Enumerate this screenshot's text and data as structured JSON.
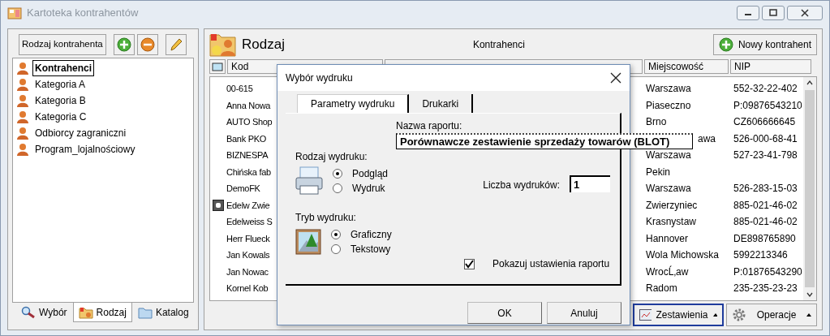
{
  "window": {
    "title": "Kartoteka kontrahentów",
    "active": false
  },
  "left_panel": {
    "type_button": "Rodzaj kontrahenta",
    "tree": [
      {
        "label": "Kontrahenci",
        "selected": true
      },
      {
        "label": "Kategoria A",
        "selected": false
      },
      {
        "label": "Kategoria B",
        "selected": false
      },
      {
        "label": "Kategoria C",
        "selected": false
      },
      {
        "label": "Odbiorcy zagraniczni",
        "selected": false
      },
      {
        "label": "Program_lojalnościowy",
        "selected": false
      }
    ],
    "tabs": [
      {
        "label": "Wybór",
        "kind": "search",
        "selected": false
      },
      {
        "label": "Rodzaj",
        "kind": "type",
        "selected": true
      },
      {
        "label": "Katalog",
        "kind": "folder",
        "selected": false
      }
    ]
  },
  "right_panel": {
    "title": "Rodzaj",
    "list_title": "Kontrahenci",
    "new_button": "Nowy kontrahent",
    "columns": {
      "kod": "Kod",
      "city": "Miejscowość",
      "nip": "NIP"
    },
    "rows": [
      {
        "kod": "00-615",
        "marked": false,
        "city": "Warszawa",
        "nip": "552-32-22-402"
      },
      {
        "kod": "Anna Nowa",
        "marked": false,
        "city": "Piaseczno",
        "nip": "P:09876543210"
      },
      {
        "kod": "AUTO Shop",
        "marked": false,
        "city": "Brno",
        "nip": "CZ606666645"
      },
      {
        "kod": "Bank PKO",
        "marked": false,
        "city": "awa",
        "nip": "526-000-68-41"
      },
      {
        "kod": "BIZNESPA",
        "marked": false,
        "city": "Warszawa",
        "nip": "527-23-41-798"
      },
      {
        "kod": "Chińska fab",
        "marked": false,
        "city": "Pekin",
        "nip": ""
      },
      {
        "kod": "DemoFK",
        "marked": false,
        "city": "Warszawa",
        "nip": "526-283-15-03"
      },
      {
        "kod": "Edelw Zwie",
        "marked": true,
        "city": "Zwierzyniec",
        "nip": "885-021-46-02"
      },
      {
        "kod": "Edelweiss S",
        "marked": false,
        "city": "Krasnystaw",
        "nip": "885-021-46-02"
      },
      {
        "kod": "Herr Flueck",
        "marked": false,
        "city": "Hannover",
        "nip": "DE898765890"
      },
      {
        "kod": "Jan Kowals",
        "marked": false,
        "city": "Wola Michowska",
        "nip": "5992213346"
      },
      {
        "kod": "Jan Nowac",
        "marked": false,
        "city": "WrocĹ‚aw",
        "nip": "P:01876543290"
      },
      {
        "kod": "Kornel Kob",
        "marked": false,
        "city": "Radom",
        "nip": "235-235-23-23"
      }
    ],
    "buttons": [
      {
        "label": "Zestawienia",
        "kind": "report",
        "focused": true
      },
      {
        "label": "Operacje",
        "kind": "gear",
        "focused": false
      }
    ]
  },
  "dialog": {
    "title": "Wybór wydruku",
    "tabs": [
      {
        "label": "Parametry wydruku",
        "selected": true
      },
      {
        "label": "Drukarki",
        "selected": false
      }
    ],
    "report_label": "Nazwa raportu:",
    "report_name": "Porównawcze zestawienie sprzedaży towarów (BLOT)",
    "print_type": {
      "label": "Rodzaj wydruku:",
      "options": [
        {
          "label": "Podgląd",
          "selected": true
        },
        {
          "label": "Wydruk",
          "selected": false
        }
      ]
    },
    "copies_label": "Liczba wydruków:",
    "copies": "1",
    "print_mode": {
      "label": "Tryb wydruku:",
      "options": [
        {
          "label": "Graficzny",
          "selected": true
        },
        {
          "label": "Tekstowy",
          "selected": false
        }
      ]
    },
    "show_settings": {
      "label": "Pokazuj ustawienia raportu",
      "checked": true
    },
    "buttons": [
      "OK",
      "Anuluj"
    ]
  }
}
